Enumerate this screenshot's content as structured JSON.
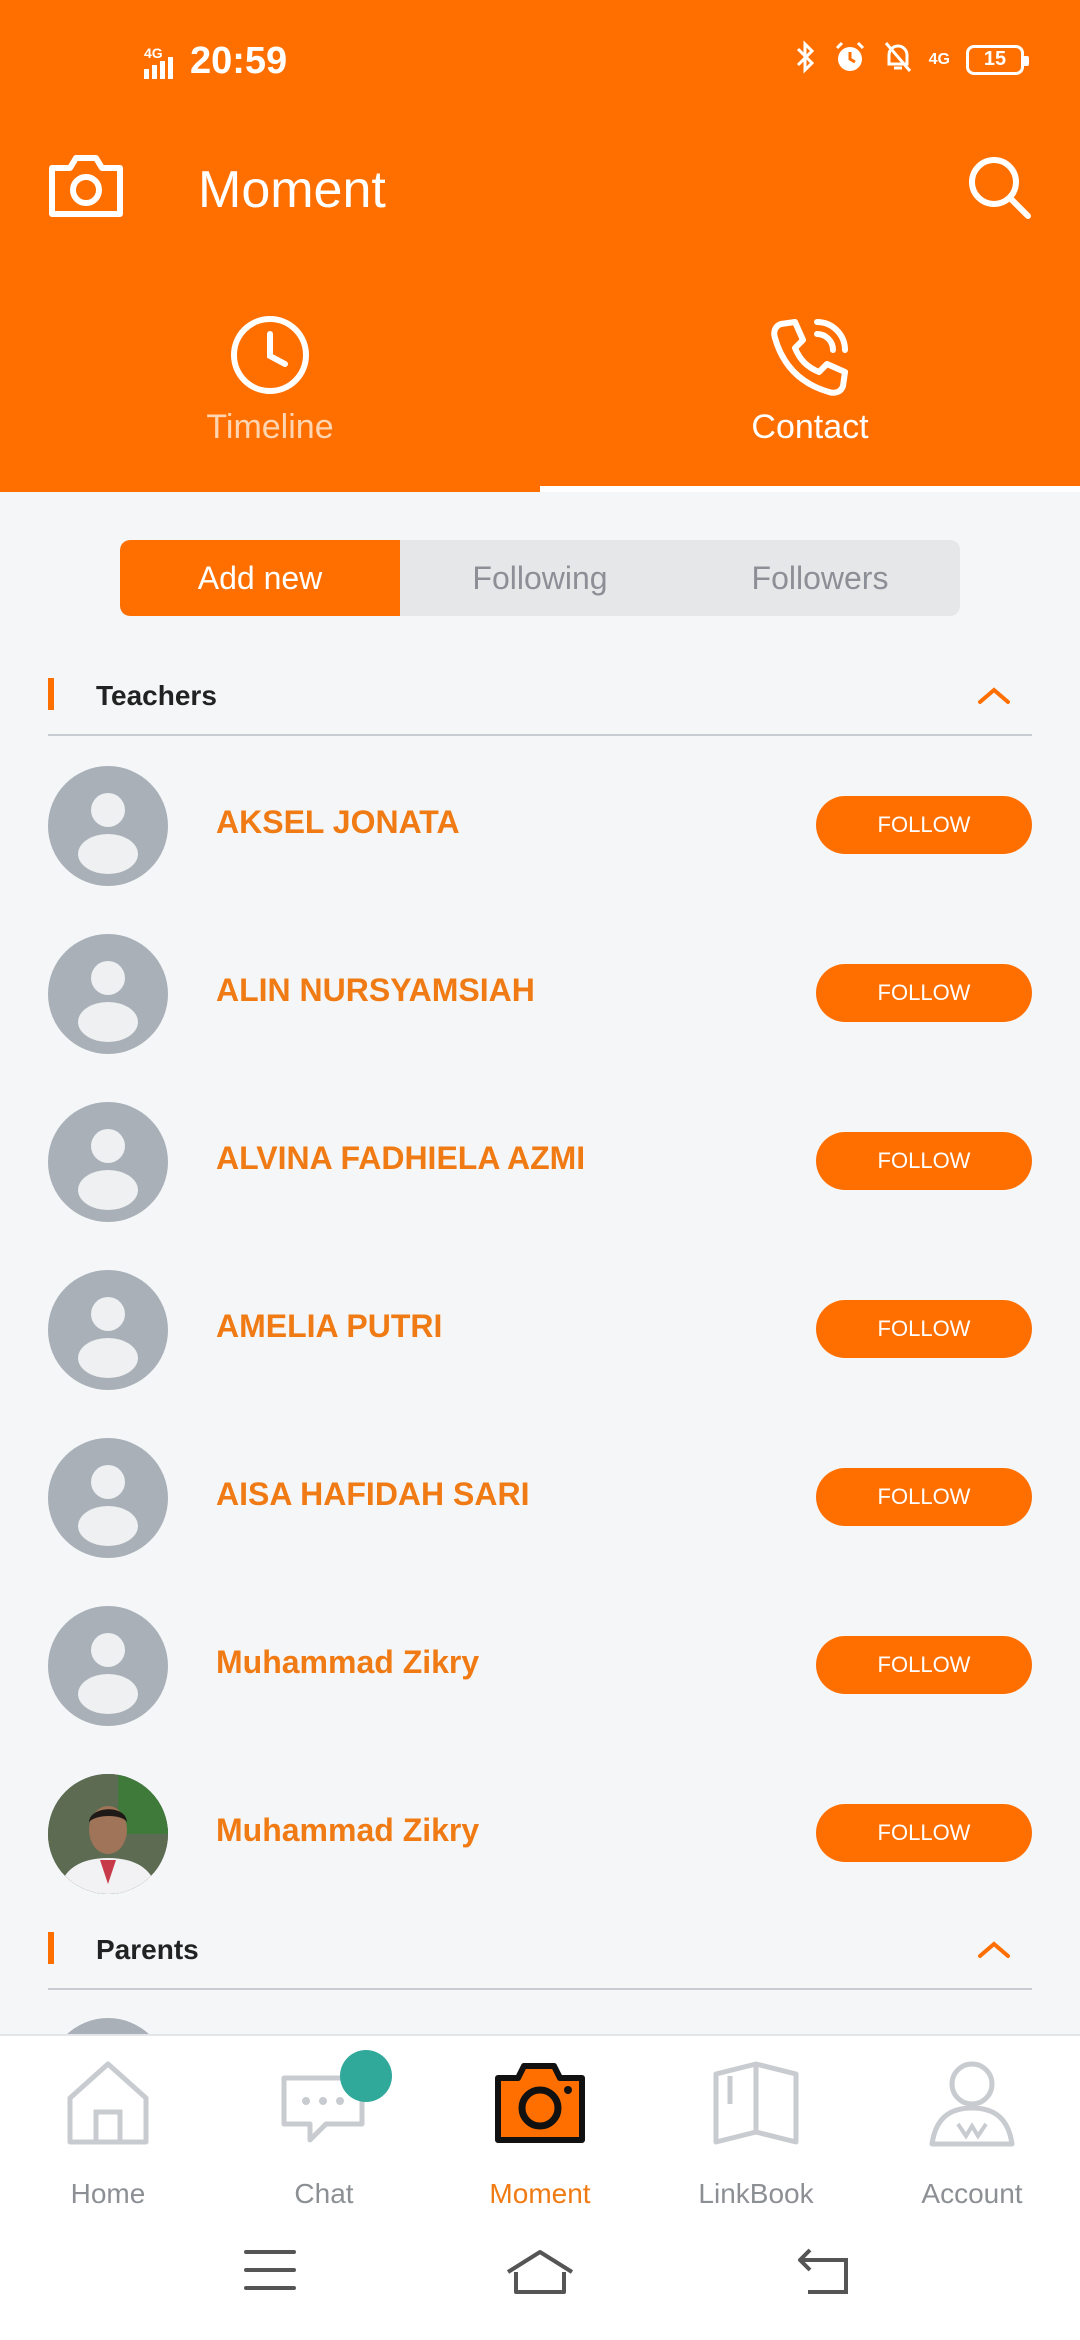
{
  "status_bar": {
    "time": "20:59",
    "network_left": "4G",
    "network_right": "4G",
    "battery": "15"
  },
  "toolbar": {
    "title": "Moment",
    "camera_icon": "camera-icon",
    "search_icon": "search-icon"
  },
  "tabs": [
    {
      "label": "Timeline",
      "icon": "clock-icon",
      "active": false
    },
    {
      "label": "Contact",
      "icon": "phone-icon",
      "active": true
    }
  ],
  "segment": [
    "Add new",
    "Following",
    "Followers"
  ],
  "sections": [
    {
      "title": "Teachers",
      "contacts": [
        {
          "name": "AKSEL JONATA",
          "button": "FOLLOW"
        },
        {
          "name": "ALIN NURSYAMSIAH",
          "button": "FOLLOW"
        },
        {
          "name": "ALVINA FADHIELA AZMI",
          "button": "FOLLOW"
        },
        {
          "name": "AMELIA PUTRI",
          "button": "FOLLOW"
        },
        {
          "name": "AISA HAFIDAH SARI",
          "button": "FOLLOW"
        },
        {
          "name": "Muhammad Zikry",
          "button": "FOLLOW"
        },
        {
          "name": "Muhammad Zikry",
          "button": "FOLLOW"
        }
      ]
    },
    {
      "title": "Parents",
      "contacts": []
    }
  ],
  "bottom_nav": [
    {
      "label": "Home",
      "icon": "home-icon"
    },
    {
      "label": "Chat",
      "icon": "chat-icon"
    },
    {
      "label": "Moment",
      "icon": "camera-icon"
    },
    {
      "label": "LinkBook",
      "icon": "book-icon"
    },
    {
      "label": "Account",
      "icon": "account-icon"
    }
  ],
  "colors": {
    "accent": "#ff6f00",
    "name_text": "#f07a13",
    "badge": "#31a99a"
  }
}
